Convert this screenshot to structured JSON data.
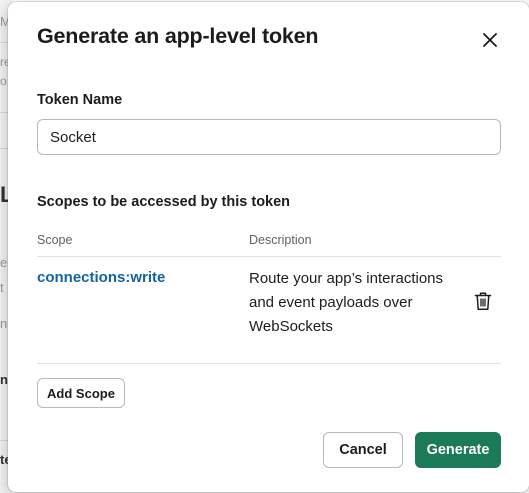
{
  "background_page": {
    "fragments": [
      "M",
      "re",
      "o",
      "L",
      "e",
      "t",
      "n",
      "ns",
      "te"
    ]
  },
  "modal": {
    "title": "Generate an app-level token",
    "token_name_label": "Token Name",
    "token_name_value": "Socket",
    "scopes_label": "Scopes to be accessed by this token",
    "table": {
      "headers": [
        "Scope",
        "Description"
      ],
      "rows": [
        {
          "scope": "connections:write",
          "description": "Route your app’s interactions and event payloads over WebSockets"
        }
      ]
    },
    "add_scope_label": "Add Scope",
    "cancel_label": "Cancel",
    "generate_label": "Generate"
  },
  "colors": {
    "link": "#1264a3",
    "primary_button": "#1b7a57",
    "text": "#1d1c1d",
    "muted": "#616061"
  },
  "icons": {
    "close": "close-icon",
    "delete": "trash-icon"
  }
}
